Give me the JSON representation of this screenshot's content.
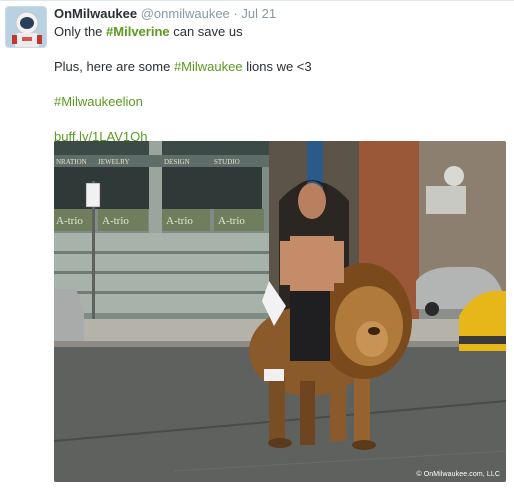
{
  "tweet": {
    "display_name": "OnMilwaukee",
    "handle": "@onmilwaukee",
    "separator": "·",
    "date": "Jul 21",
    "line1_prefix": "Only the ",
    "line1_hashtag": "#Milverine",
    "line1_suffix": " can save us",
    "line2_prefix": "Plus, here are some ",
    "line2_hashtag": "#Milwaukee",
    "line2_suffix": " lions we <3",
    "line3_hashtag": "#Milwaukeelion",
    "link": "buff.ly/1LAV1Oh"
  },
  "photo": {
    "signs": [
      "A-trio",
      "A-trio",
      "A-trio",
      "A-trio"
    ],
    "banner_jewelry": "JEWELRY",
    "banner_design": "DESIGN",
    "banner_studio": "STUDIO",
    "banner_left": "NRATION",
    "credit": "© OnMilwaukee.com, LLC"
  },
  "colors": {
    "hashtag": "#5b9a1f",
    "muted": "#8899a6",
    "text": "#292f33"
  }
}
